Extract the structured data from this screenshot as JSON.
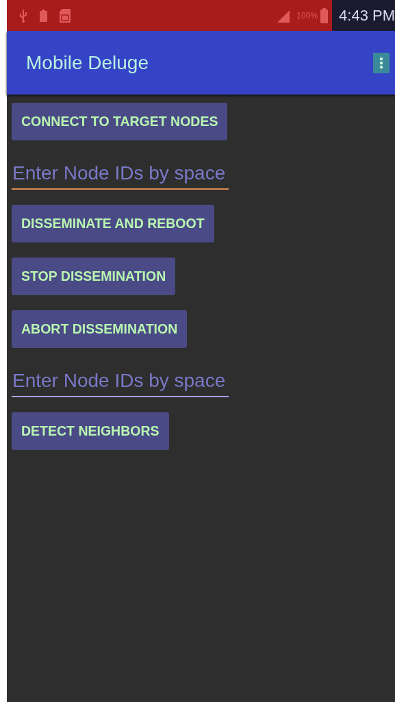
{
  "status_bar": {
    "battery": "100%",
    "time": "4:43 PM"
  },
  "app_bar": {
    "title": "Mobile Deluge"
  },
  "items": [
    {
      "kind": "button",
      "label": "CONNECT TO TARGET NODES"
    },
    {
      "kind": "field",
      "placeholder": "Enter Node IDs by space",
      "focused": true
    },
    {
      "kind": "button",
      "label": "DISSEMINATE AND REBOOT"
    },
    {
      "kind": "button",
      "label": "STOP DISSEMINATION"
    },
    {
      "kind": "button",
      "label": "ABORT DISSEMINATION"
    },
    {
      "kind": "field",
      "placeholder": "Enter Node IDs by space",
      "focused": false
    },
    {
      "kind": "button",
      "label": "DETECT NEIGHBORS"
    }
  ]
}
